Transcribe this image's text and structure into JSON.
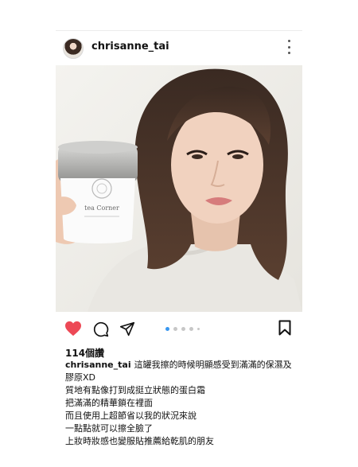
{
  "post": {
    "username": "chrisanne_tai",
    "likes": "114個讚",
    "caption_first": "這罐我擦的時候明顯感受到滿滿的保濕及膠原XD",
    "caption_lines": [
      "質地有點像打到成挺立狀態的蛋白霜",
      "把滿滿的精華鎖在裡面",
      "而且使用上超節省以我的狀況來說",
      "一點點就可以擦全臉了",
      "上妝時妝感也變服貼推薦給乾肌的朋友"
    ],
    "jar_label": "tea Corner",
    "carousel": {
      "count": 5,
      "active_index": 0
    }
  },
  "icons": {
    "heart": "heart-icon",
    "comment": "comment-icon",
    "share": "share-icon",
    "save": "bookmark-icon",
    "more": "more-options-icon"
  },
  "colors": {
    "like_red": "#ed4956",
    "dot_active": "#3897f0",
    "dot_inactive": "#c7c7c7"
  }
}
